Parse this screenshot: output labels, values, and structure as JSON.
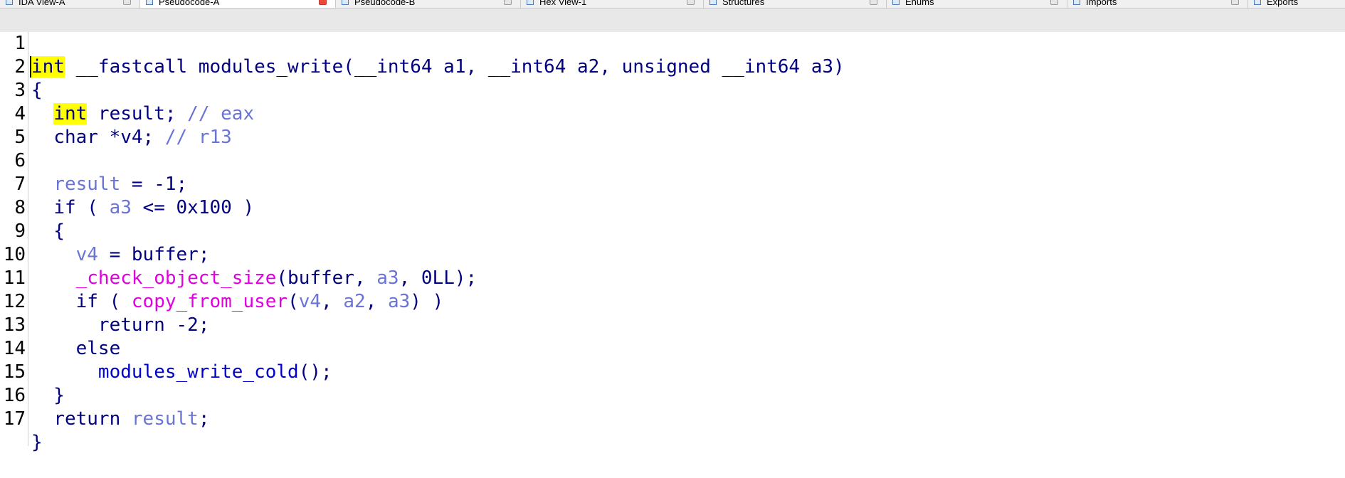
{
  "tabs": [
    {
      "label": "IDA View-A",
      "active": false
    },
    {
      "label": "Pseudocode-A",
      "active": true
    },
    {
      "label": "Pseudocode-B",
      "active": false
    },
    {
      "label": "Hex View-1",
      "active": false
    },
    {
      "label": "Structures",
      "active": false
    },
    {
      "label": "Enums",
      "active": false
    },
    {
      "label": "Imports",
      "active": false
    },
    {
      "label": "Exports",
      "active": false
    }
  ],
  "code": {
    "line_numbers": [
      "1",
      "2",
      "3",
      "4",
      "5",
      "6",
      "7",
      "8",
      "9",
      "10",
      "11",
      "12",
      "13",
      "14",
      "15",
      "16",
      "17"
    ],
    "l1": {
      "kw": "int",
      "rest": " __fastcall modules_write(__int64 a1, __int64 a2, unsigned __int64 a3)"
    },
    "l2": "{",
    "l3": {
      "indent": "  ",
      "kw": "int",
      "rest": " result; ",
      "comment": "// eax"
    },
    "l4": {
      "indent": "  ",
      "rest": "char *v4; ",
      "comment": "// r13"
    },
    "l5": "",
    "l6": {
      "indent": "  ",
      "var": "result",
      "rest": " = -1;"
    },
    "l7": {
      "indent": "  ",
      "pre": "if ( ",
      "var": "a3",
      "post": " <= 0x100 )"
    },
    "l8": "  {",
    "l9": {
      "indent": "    ",
      "var": "v4",
      "post": " = buffer;"
    },
    "l10": {
      "indent": "    ",
      "fn": "_check_object_size",
      "p1": "(buffer, ",
      "var": "a3",
      "p2": ", 0LL);"
    },
    "l11": {
      "indent": "    ",
      "pre": "if ( ",
      "fn": "copy_from_user",
      "p1": "(",
      "v1": "v4",
      "c1": ", ",
      "v2": "a2",
      "c2": ", ",
      "v3": "a3",
      "post": ") )"
    },
    "l12": "      return -2;",
    "l13": "    else",
    "l14": {
      "indent": "      ",
      "fn": "modules_write_cold",
      "post": "();"
    },
    "l15": "  }",
    "l16": {
      "indent": "  ",
      "pre": "return ",
      "var": "result",
      "post": ";"
    },
    "l17": "}"
  },
  "colors": {
    "keyword_highlight": "#ffff00",
    "code_text": "#000080",
    "local_var": "#6a74d8",
    "import_function": "#e000e0",
    "user_function": "#0000cc",
    "current_line": "#e8e8e8"
  }
}
